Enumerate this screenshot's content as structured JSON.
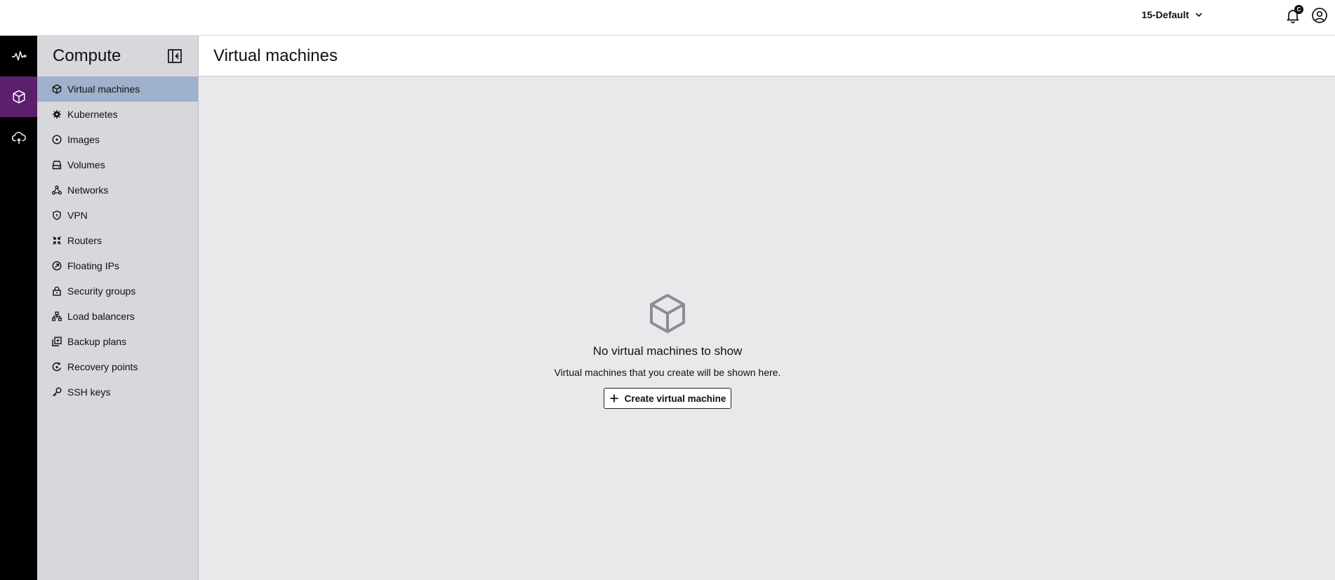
{
  "topbar": {
    "project": "15-Default",
    "notification_badge": "C",
    "icons": [
      "chevron-down-icon",
      "bell-icon",
      "user-circle-icon"
    ]
  },
  "rail": {
    "items": [
      {
        "icon": "activity-icon",
        "active": false
      },
      {
        "icon": "cube-icon",
        "active": true
      },
      {
        "icon": "cloud-upload-icon",
        "active": false
      }
    ]
  },
  "sidebar": {
    "title": "Compute",
    "items": [
      {
        "label": "Virtual machines",
        "icon": "cube-icon",
        "active": true
      },
      {
        "label": "Kubernetes",
        "icon": "kubernetes-icon",
        "active": false
      },
      {
        "label": "Images",
        "icon": "disc-icon",
        "active": false
      },
      {
        "label": "Volumes",
        "icon": "hard-drive-icon",
        "active": false
      },
      {
        "label": "Networks",
        "icon": "network-icon",
        "active": false
      },
      {
        "label": "VPN",
        "icon": "shield-icon",
        "active": false
      },
      {
        "label": "Routers",
        "icon": "router-icon",
        "active": false
      },
      {
        "label": "Floating IPs",
        "icon": "floating-ip-icon",
        "active": false
      },
      {
        "label": "Security groups",
        "icon": "lock-icon",
        "active": false
      },
      {
        "label": "Load balancers",
        "icon": "load-balancer-icon",
        "active": false
      },
      {
        "label": "Backup plans",
        "icon": "backup-icon",
        "active": false
      },
      {
        "label": "Recovery points",
        "icon": "recovery-icon",
        "active": false
      },
      {
        "label": "SSH keys",
        "icon": "key-icon",
        "active": false
      }
    ]
  },
  "main": {
    "title": "Virtual machines",
    "empty": {
      "title": "No virtual machines to show",
      "subtitle": "Virtual machines that you create will be shown here.",
      "button_label": "Create virtual machine"
    }
  },
  "colors": {
    "rail_bg": "#000000",
    "rail_active": "#5b1f6b",
    "sidebar_bg": "#d7d7dc",
    "sidebar_active": "#9fb1cc",
    "main_bg": "#e9e9ec"
  }
}
